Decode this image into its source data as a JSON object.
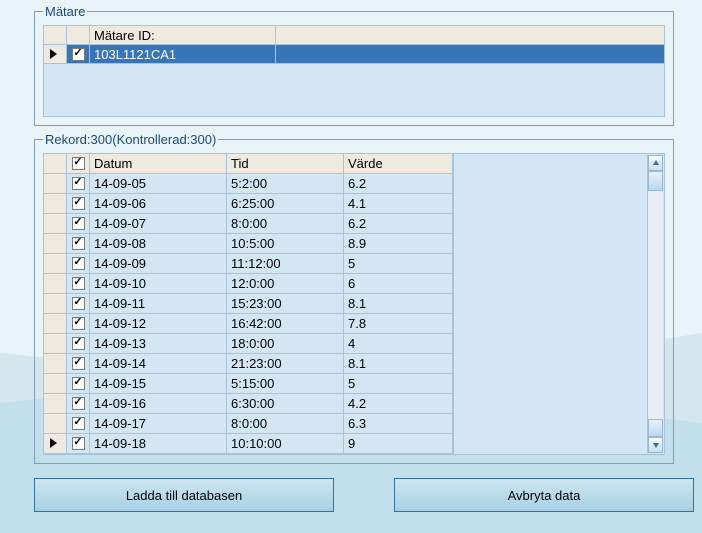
{
  "matare": {
    "legend": "Mätare",
    "columns": {
      "id": "Mätare ID:"
    },
    "rows": [
      {
        "checked": true,
        "selected": true,
        "current": true,
        "id": "103L1121CA1"
      }
    ]
  },
  "rekord": {
    "legend_prefix": "Rekord:",
    "total": 300,
    "checked_label": "Kontrollerad:",
    "checked_count": 300,
    "header_checked": true,
    "columns": {
      "datum": "Datum",
      "tid": "Tid",
      "varde": "Värde"
    },
    "rows": [
      {
        "checked": true,
        "datum": "14-09-05",
        "tid": "5:2:00",
        "varde": "6.2"
      },
      {
        "checked": true,
        "datum": "14-09-06",
        "tid": "6:25:00",
        "varde": "4.1"
      },
      {
        "checked": true,
        "datum": "14-09-07",
        "tid": "8:0:00",
        "varde": "6.2"
      },
      {
        "checked": true,
        "datum": "14-09-08",
        "tid": "10:5:00",
        "varde": "8.9"
      },
      {
        "checked": true,
        "datum": "14-09-09",
        "tid": "11:12:00",
        "varde": "5"
      },
      {
        "checked": true,
        "datum": "14-09-10",
        "tid": "12:0:00",
        "varde": "6"
      },
      {
        "checked": true,
        "datum": "14-09-11",
        "tid": "15:23:00",
        "varde": "8.1"
      },
      {
        "checked": true,
        "datum": "14-09-12",
        "tid": "16:42:00",
        "varde": "7.8"
      },
      {
        "checked": true,
        "datum": "14-09-13",
        "tid": "18:0:00",
        "varde": "4"
      },
      {
        "checked": true,
        "datum": "14-09-14",
        "tid": "21:23:00",
        "varde": "8.1"
      },
      {
        "checked": true,
        "datum": "14-09-15",
        "tid": "5:15:00",
        "varde": "5"
      },
      {
        "checked": true,
        "datum": "14-09-16",
        "tid": "6:30:00",
        "varde": "4.2"
      },
      {
        "checked": true,
        "datum": "14-09-17",
        "tid": "8:0:00",
        "varde": "6.3"
      },
      {
        "checked": true,
        "current": true,
        "datum": "14-09-18",
        "tid": "10:10:00",
        "varde": "9"
      }
    ]
  },
  "buttons": {
    "load": "Ladda till databasen",
    "abort": "Avbryta data"
  }
}
